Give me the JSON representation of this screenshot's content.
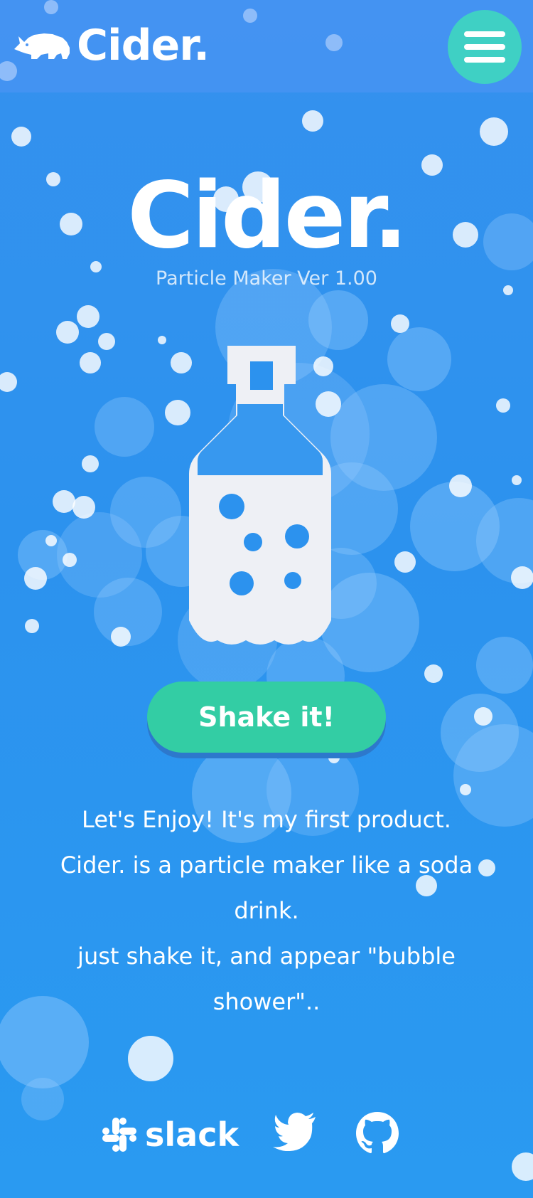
{
  "header": {
    "logo_text": "Cider.",
    "menu_icon": "hamburger-menu-icon"
  },
  "hero": {
    "title": "Cider.",
    "subtitle": "Particle Maker Ver 1.00"
  },
  "illustration": {
    "icon": "soda-bottle-icon"
  },
  "actions": {
    "shake_label": "Shake it!"
  },
  "description": {
    "lines": [
      "Let's Enjoy! It's my first product.",
      "Cider. is a particle maker like a soda drink.",
      "just shake it, and appear \"bubble shower\".."
    ]
  },
  "social": {
    "slack_label": "slack",
    "icons": [
      "slack-icon",
      "twitter-icon",
      "github-icon"
    ]
  },
  "colors": {
    "background": "#2c92ee",
    "header": "#4f98f4",
    "menu_button": "#3fd0c4",
    "shake_button": "#33cda4",
    "bottle": "#eef0f5",
    "text": "#ffffff"
  }
}
